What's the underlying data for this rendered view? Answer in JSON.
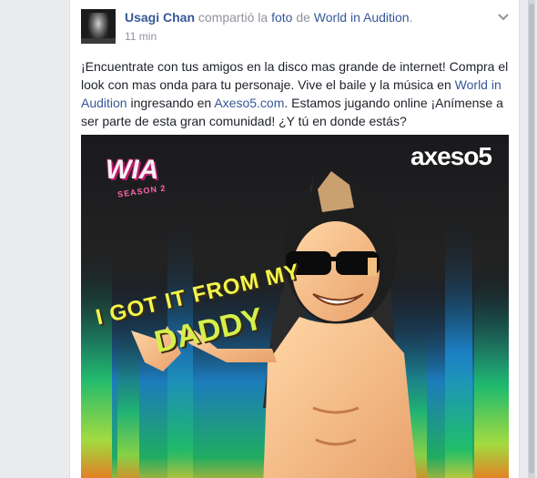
{
  "post": {
    "author": "Usagi Chan",
    "shared_text": "compartió la",
    "photo_link": "foto",
    "of_text": "de",
    "page_link": "World in Audition",
    "period": ".",
    "timestamp": "11 min",
    "body_part1": "¡Encuentrate con tus amigos en la disco mas grande de internet! Compra el look con mas onda para tu personaje. Vive el baile y la música en ",
    "body_link1": "World in Audition",
    "body_part2": " ingresando en ",
    "body_link2": "Axeso5.com",
    "body_part3": ". Estamos jugando online ¡Anímense a ser parte de esta gran comunidad! ¿Y tú en donde estás?"
  },
  "photo": {
    "brand_logo": "axeso5",
    "game_logo": "WIA",
    "game_season": "SEASON 2",
    "slogan_line1": "I GOT IT FROM MY",
    "slogan_line2": "DADDY"
  },
  "icons": {
    "menu": "chevron-down-icon"
  },
  "colors": {
    "link": "#365899",
    "meta": "#90949c",
    "text": "#1d2129",
    "background": "#e9ebee"
  }
}
